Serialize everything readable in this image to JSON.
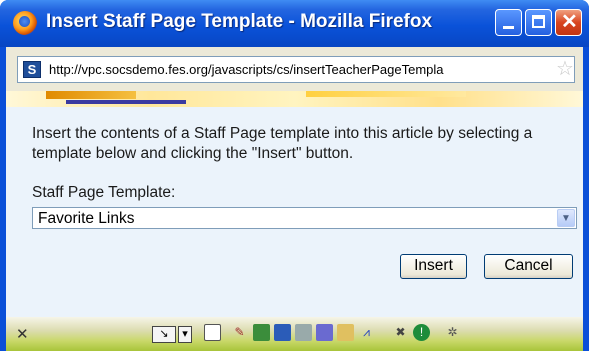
{
  "window": {
    "title": "Insert Staff Page Template - Mozilla Firefox",
    "icon": "firefox-icon",
    "controls": {
      "minimize": "minimize-icon",
      "maximize": "maximize-icon",
      "close": "close-icon"
    }
  },
  "addressbar": {
    "url": "http://vpc.socsdemo.fes.org/javascripts/cs/insertTeacherPageTempla",
    "site_icon": "S",
    "bookmark_icon": "☆"
  },
  "dialog": {
    "instructions": "Insert the contents of a Staff Page template into this article by selecting a template below and clicking the \"Insert\" button.",
    "field_label": "Staff Page Template:",
    "selected_template": "Favorite Links",
    "insert_label": "Insert",
    "cancel_label": "Cancel"
  },
  "colors": {
    "titlebar": "#0a52d9",
    "content_bg": "#ebf3fb",
    "close_button": "#d8451f"
  }
}
